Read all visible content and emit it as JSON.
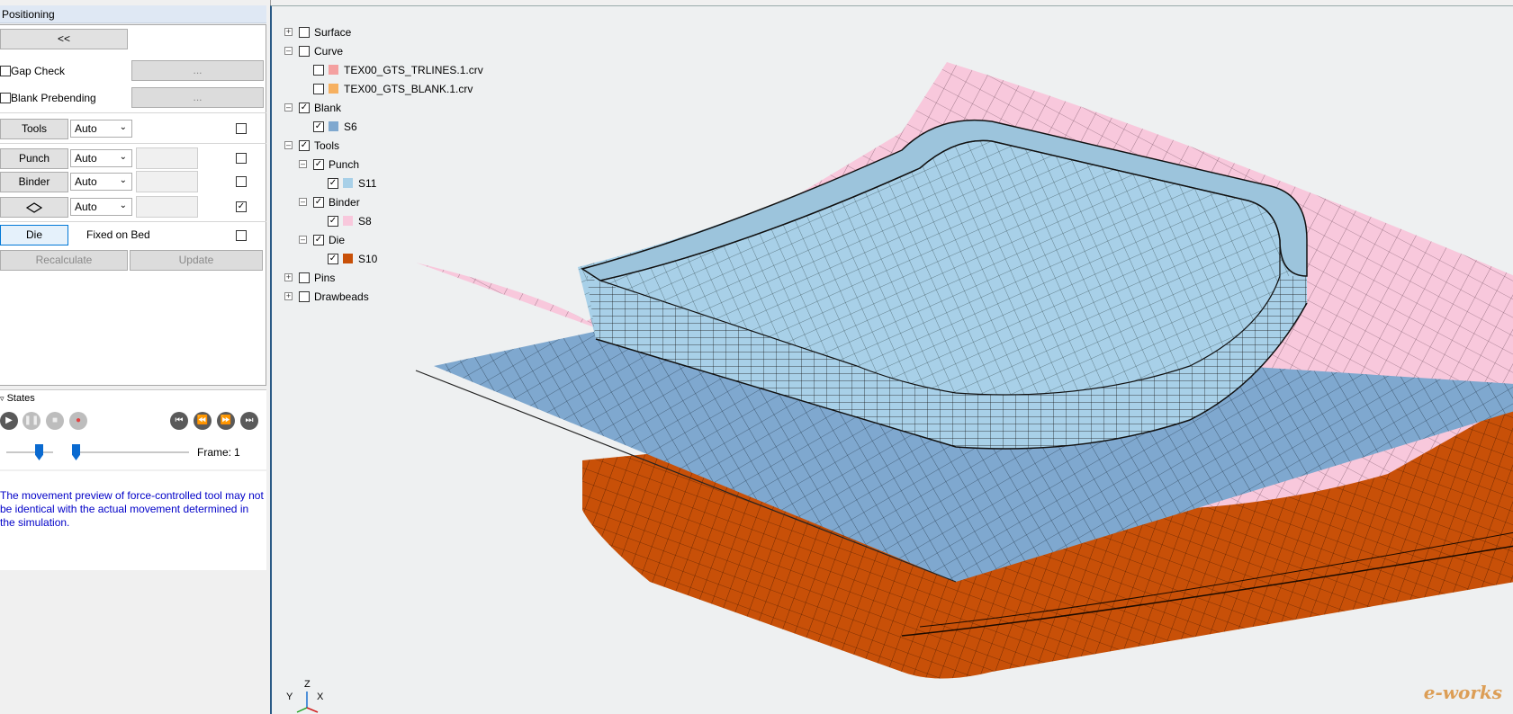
{
  "panel": {
    "title": "Positioning",
    "collapse_label": "<<",
    "gap_check": {
      "label": "Gap Check",
      "button": "..."
    },
    "blank_prebending": {
      "label": "Blank Prebending",
      "button": "..."
    },
    "tools_row": {
      "label": "Tools",
      "mode": "Auto"
    },
    "punch_row": {
      "label": "Punch",
      "mode": "Auto"
    },
    "binder_row": {
      "label": "Binder",
      "mode": "Auto"
    },
    "shape_row": {
      "mode": "Auto"
    },
    "die_row": {
      "label": "Die",
      "fixed_label": "Fixed on Bed"
    },
    "recalculate": "Recalculate",
    "update": "Update"
  },
  "states": {
    "title": "States",
    "frame_label": "Frame:",
    "frame_value": "1"
  },
  "message": "The movement preview of force-controlled tool may not be identical with the actual movement determined in the simulation.",
  "tree": {
    "surface": "Surface",
    "curve": "Curve",
    "curve_item1": "TEX00_GTS_TRLINES.1.crv",
    "curve_item2": "TEX00_GTS_BLANK.1.crv",
    "blank": "Blank",
    "blank_item": "S6",
    "tools": "Tools",
    "punch": "Punch",
    "punch_item": "S11",
    "binder": "Binder",
    "binder_item": "S8",
    "die": "Die",
    "die_item": "S10",
    "pins": "Pins",
    "drawbeads": "Drawbeads"
  },
  "axes": {
    "z": "Z",
    "y": "Y",
    "x": "X"
  },
  "watermark": "e-works",
  "colors": {
    "trlines": "#f4a0a0",
    "blank_curve": "#f6b060",
    "blank": "#7fa8cf",
    "punch": "#a8d0e8",
    "binder": "#f8c8dc",
    "die": "#c85008"
  }
}
